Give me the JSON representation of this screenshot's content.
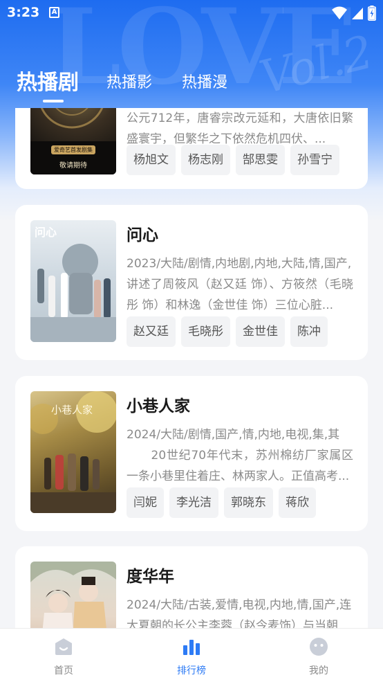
{
  "status_bar": {
    "time": "3:23",
    "app_icon_letter": "A",
    "icons": [
      "wifi-icon",
      "signal-icon",
      "battery-charging-icon"
    ]
  },
  "tabs": [
    {
      "label": "热播剧",
      "active": true
    },
    {
      "label": "热播影",
      "active": false
    },
    {
      "label": "热播漫",
      "active": false
    }
  ],
  "shows": [
    {
      "title": "",
      "meta": "",
      "desc": "公元712年，唐睿宗改元延和，大唐依旧繁盛寰宇，但繁华之下依然危机四伏、...",
      "cast": [
        "杨旭文",
        "杨志刚",
        "郜思雯",
        "孙雪宁"
      ],
      "poster_caption_top": "爱奇艺首发剧集",
      "poster_caption_bottom": "敬请期待"
    },
    {
      "title": "问心",
      "meta": "2023/大陆/剧情,内地剧,内地,大陆,情,国产,",
      "desc": "讲述了周筱风（赵又廷 饰）、方筱然（毛晓彤 饰）和林逸（金世佳 饰）三位心脏...",
      "cast": [
        "赵又廷",
        "毛晓彤",
        "金世佳",
        "陈冲"
      ],
      "poster_caption_top": "问心"
    },
    {
      "title": "小巷人家",
      "meta": "2024/大陆/剧情,国产,情,内地,电视,集,其",
      "desc": "　　20世纪70年代末，苏州棉纺厂家属区一条小巷里住着庄、林两家人。正值高考...",
      "cast": [
        "闫妮",
        "李光洁",
        "郭晓东",
        "蒋欣"
      ],
      "poster_caption_top": "小巷人家"
    },
    {
      "title": "度华年",
      "meta": "2024/大陆/古装,爱情,电视,内地,情,国产,连",
      "desc": "大夏朝的长公主李蓉（赵今麦饰）与当朝",
      "cast": []
    }
  ],
  "bottom_nav": [
    {
      "label": "首页",
      "icon": "home-icon",
      "active": false
    },
    {
      "label": "排行榜",
      "icon": "bar-chart-icon",
      "active": true
    },
    {
      "label": "我的",
      "icon": "smiley-icon",
      "active": false
    }
  ],
  "colors": {
    "accent": "#2d7bf5",
    "header_blue": "#1e6cf0",
    "chip_bg": "#f2f3f5",
    "meta_text": "#8a8a8a",
    "title_text": "#1a1a1a"
  }
}
